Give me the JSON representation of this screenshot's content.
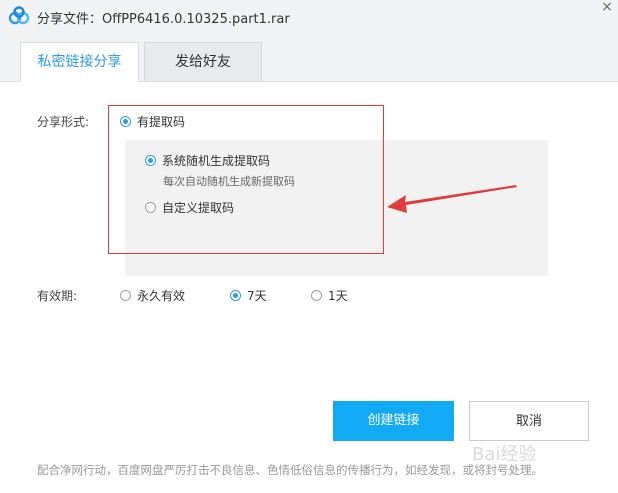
{
  "window": {
    "title": "分享文件：OffPP6416.0.10325.part1.rar",
    "close_glyph": "×"
  },
  "tabs": [
    {
      "label": "私密链接分享",
      "active": true
    },
    {
      "label": "发给好友",
      "active": false
    }
  ],
  "share_form": {
    "label": "分享形式:",
    "option_code": "有提取码",
    "sub_random": "系统随机生成提取码",
    "sub_random_hint": "每次自动随机生成新提取码",
    "sub_custom": "自定义提取码"
  },
  "validity": {
    "label": "有效期:",
    "options": [
      "永久有效",
      "7天",
      "1天"
    ],
    "selected": "7天"
  },
  "buttons": {
    "create": "创建链接",
    "cancel": "取消"
  },
  "notice": "配合净网行动，百度网盘严厉打击不良信息、色情低俗信息的传播行为，如经发现，或将封号处理。",
  "watermark": "Bai经验",
  "colors": {
    "accent": "#2e9bea",
    "primary_button": "#12aaf5",
    "annotation_red": "#e03c3c"
  }
}
